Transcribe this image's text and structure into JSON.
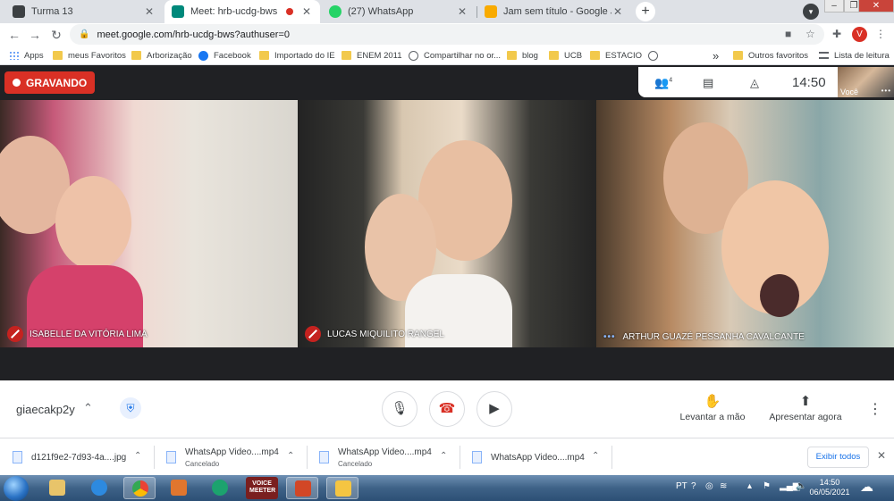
{
  "browser": {
    "tabs": [
      {
        "title": "Turma 13",
        "favicon_color": "#3c4043",
        "active": false
      },
      {
        "title": "Meet: hrb-ucdg-bws",
        "favicon_color": "#00897b",
        "active": true
      },
      {
        "title": "(27) WhatsApp",
        "favicon_color": "#25d366",
        "active": false
      },
      {
        "title": "Jam sem título - Google Jamboard",
        "favicon_color": "#f9ab00",
        "active": false
      }
    ],
    "new_tab_label": "+",
    "url": "meet.google.com/hrb-ucdg-bws?authuser=0",
    "profile_initial": "V",
    "bookmarks": [
      {
        "label": "Apps",
        "icon": "apps-icon"
      },
      {
        "label": "meus Favoritos",
        "icon": "folder-icon"
      },
      {
        "label": "Arborização",
        "icon": "folder-icon"
      },
      {
        "label": "Facebook",
        "icon": "facebook-icon"
      },
      {
        "label": "Importado do IE",
        "icon": "folder-icon"
      },
      {
        "label": "ENEM 2011",
        "icon": "folder-icon"
      },
      {
        "label": "Compartilhar no or...",
        "icon": "globe-icon"
      },
      {
        "label": "blog",
        "icon": "folder-icon"
      },
      {
        "label": "UCB",
        "icon": "folder-icon"
      },
      {
        "label": "ESTACIO",
        "icon": "folder-icon"
      },
      {
        "label": "",
        "icon": "globe-icon"
      }
    ],
    "bookmarks_overflow": "»",
    "other_favorites": "Outros favoritos",
    "reading_list": "Lista de leitura"
  },
  "meet": {
    "recording_label": "GRAVANDO",
    "people_count": "4",
    "time": "14:50",
    "self_label": "Você",
    "participants": [
      {
        "name": "ISABELLE DA VITÓRIA LIMA",
        "muted": true
      },
      {
        "name": "LUCAS MIQUILITO RANGEL",
        "muted": true
      },
      {
        "name": "ARTHUR GUAZÉ PESSANHA CAVALCANTE",
        "muted": false
      }
    ],
    "meeting_code": "giaecakp2y",
    "raise_hand": "Levantar a mão",
    "present_now": "Apresentar agora"
  },
  "downloads": {
    "items": [
      {
        "name": "d121f9e2-7d93-4a....jpg",
        "status": ""
      },
      {
        "name": "WhatsApp Video....mp4",
        "status": "Cancelado"
      },
      {
        "name": "WhatsApp Video....mp4",
        "status": "Cancelado"
      },
      {
        "name": "WhatsApp Video....mp4",
        "status": ""
      }
    ],
    "show_all": "Exibir todos"
  },
  "taskbar": {
    "voicemeeter_label": "VOICE MEETER",
    "language": "PT",
    "time": "14:50",
    "date": "06/05/2021"
  },
  "colors": {
    "recording": "#d93025",
    "meet_bg": "#202124",
    "accent": "#1a73e8"
  }
}
